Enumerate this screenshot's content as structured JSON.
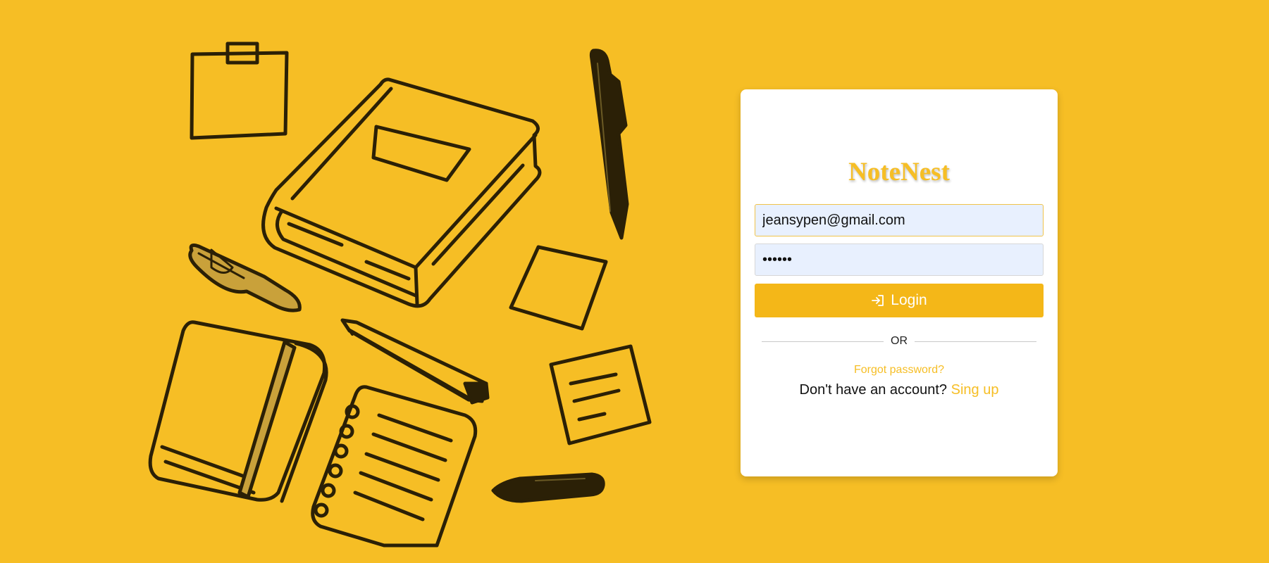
{
  "brand": {
    "title": "NoteNest"
  },
  "login_form": {
    "email_value": "jeansypen@gmail.com",
    "password_value": "••••••",
    "login_label": "Login",
    "login_icon": "login-icon",
    "divider_text": "OR",
    "forgot_password": "Forgot password?",
    "signup_prompt": "Don't have an account?",
    "signup_link": "Sing up"
  },
  "colors": {
    "background": "#F6BE25",
    "accent": "#F4B718",
    "input_fill": "#E8F0FE",
    "ink": "#2B2006"
  },
  "illustration": {
    "icons": [
      "sticky-note-icon",
      "book-icon",
      "pen-icon",
      "marker-icon",
      "notebook-icon",
      "pencil-icon",
      "spiral-notepad-icon",
      "note-card-icon",
      "highlighter-icon"
    ]
  }
}
